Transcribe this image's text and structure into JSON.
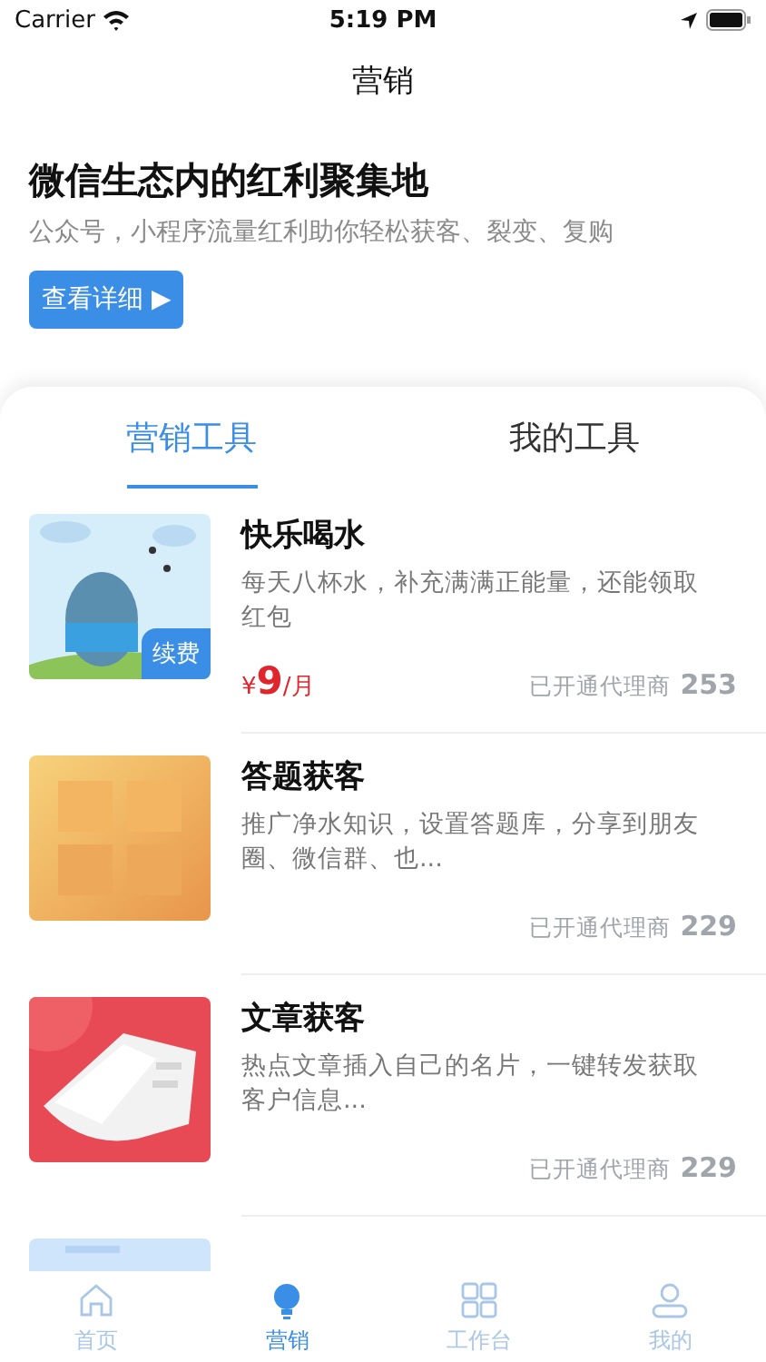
{
  "status_bar": {
    "carrier": "Carrier",
    "time": "5:19 PM"
  },
  "nav": {
    "title": "营销"
  },
  "banner": {
    "title": "微信生态内的红利聚集地",
    "subtitle": "公众号，小程序流量红利助你轻松获客、裂变、复购",
    "button": "查看详细 ▶"
  },
  "tabs": [
    {
      "label": "营销工具",
      "selected": true
    },
    {
      "label": "我的工具",
      "selected": false
    }
  ],
  "items": [
    {
      "title": "快乐喝水",
      "description": "每天八杯水，补充满满正能量，还能领取红包",
      "badge": "续费",
      "price": {
        "currency": "¥",
        "amount": "9",
        "unit": "/月"
      },
      "agents_label": "已开通代理商",
      "agents_count": "253"
    },
    {
      "title": "答题获客",
      "description": "推广净水知识，设置答题库，分享到朋友圈、微信群、也...",
      "agents_label": "已开通代理商",
      "agents_count": "229"
    },
    {
      "title": "文章获客",
      "description": "热点文章插入自己的名片，一键转发获取客户信息...",
      "agents_label": "已开通代理商",
      "agents_count": "229"
    }
  ],
  "tab_bar": [
    {
      "label": "首页",
      "selected": false
    },
    {
      "label": "营销",
      "selected": true
    },
    {
      "label": "工作台",
      "selected": false
    },
    {
      "label": "我的",
      "selected": false
    }
  ]
}
